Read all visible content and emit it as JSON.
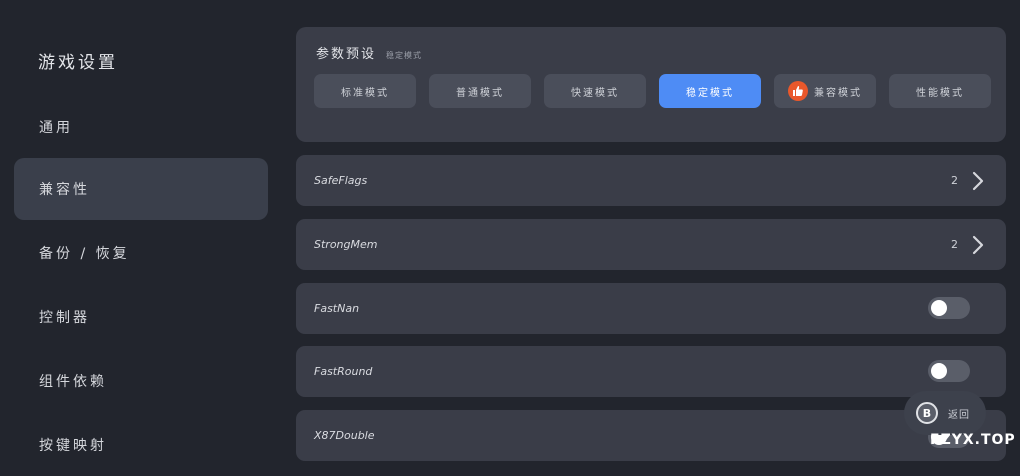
{
  "sidebar": {
    "title": "游戏设置",
    "items": [
      {
        "label": "通用"
      },
      {
        "label": "兼容性"
      },
      {
        "label": "备份 / 恢复"
      },
      {
        "label": "控制器"
      },
      {
        "label": "组件依赖"
      },
      {
        "label": "按键映射"
      }
    ],
    "active_index": 1
  },
  "presets": {
    "title": "参数预设",
    "subtitle": "稳定模式",
    "buttons": [
      {
        "label": "标准模式"
      },
      {
        "label": "普通模式"
      },
      {
        "label": "快速模式"
      },
      {
        "label": "稳定模式"
      },
      {
        "label": "兼容模式",
        "icon": "thumbs-up-icon"
      },
      {
        "label": "性能模式"
      }
    ],
    "active_index": 3
  },
  "settings": [
    {
      "label": "SafeFlags",
      "value": "2",
      "control": "chevron"
    },
    {
      "label": "StrongMem",
      "value": "2",
      "control": "chevron"
    },
    {
      "label": "FastNan",
      "control": "toggle",
      "enabled": false
    },
    {
      "label": "FastRound",
      "control": "toggle",
      "enabled": false
    },
    {
      "label": "X87Double",
      "control": "toggle",
      "enabled": false
    }
  ],
  "back_button": {
    "key": "B",
    "label": "返回"
  },
  "watermark": "FZYX.TOP",
  "colors": {
    "background": "#22252d",
    "panel": "#3a3d48",
    "accent": "#4e8cf5",
    "badge": "#e9582b"
  }
}
